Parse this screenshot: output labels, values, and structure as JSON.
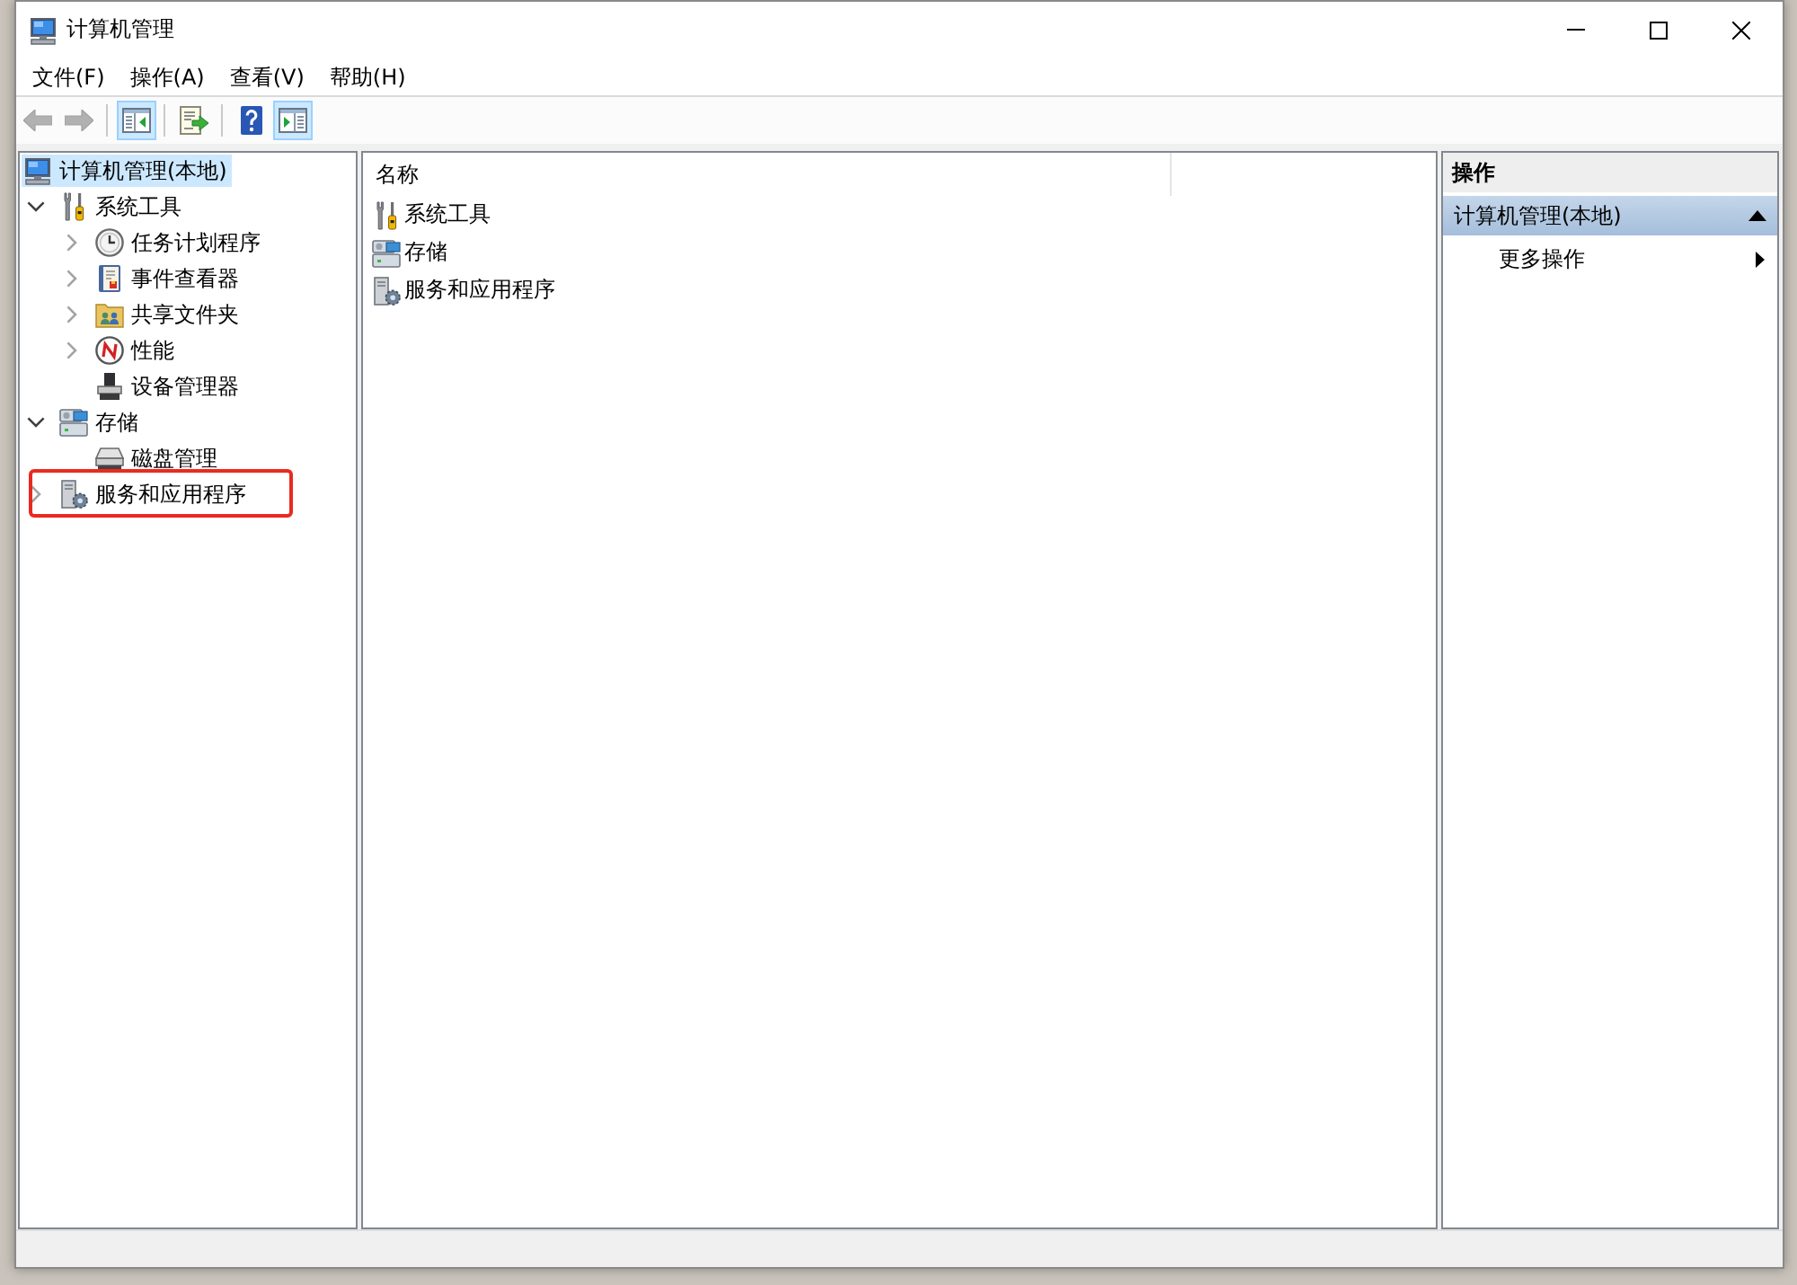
{
  "window": {
    "title": "计算机管理"
  },
  "menu": [
    "文件(F)",
    "操作(A)",
    "查看(V)",
    "帮助(H)"
  ],
  "toolbar": {
    "groups": [
      {
        "buttons": [
          {
            "disabled": true,
            "pressed": false
          },
          {
            "disabled": true,
            "pressed": false
          }
        ]
      },
      {
        "buttons": [
          {
            "disabled": false,
            "pressed": true
          }
        ]
      },
      {
        "buttons": [
          {
            "disabled": false,
            "pressed": false
          }
        ]
      },
      {
        "buttons": [
          {
            "disabled": false,
            "pressed": false
          },
          {
            "disabled": false,
            "pressed": true
          }
        ]
      }
    ]
  },
  "tree": {
    "root": {
      "label": "计算机管理(本地)",
      "selected": true,
      "children": [
        {
          "label": "系统工具",
          "expanded": true,
          "selected": false,
          "outlined": false,
          "children": [
            {
              "label": "任务计划程序",
              "expanded": false,
              "selected": false,
              "outlined": false
            },
            {
              "label": "事件查看器",
              "expanded": false,
              "selected": false,
              "outlined": false
            },
            {
              "label": "共享文件夹",
              "expanded": false,
              "selected": false,
              "outlined": false
            },
            {
              "label": "性能",
              "expanded": false,
              "selected": false,
              "outlined": false
            },
            {
              "label": "设备管理器",
              "selected": false,
              "outlined": false
            }
          ]
        },
        {
          "label": "存储",
          "expanded": true,
          "selected": false,
          "outlined": false,
          "children": [
            {
              "label": "磁盘管理",
              "selected": false,
              "outlined": false
            }
          ]
        },
        {
          "label": "服务和应用程序",
          "expanded": false,
          "selected": false,
          "outlined": true
        }
      ]
    }
  },
  "list": {
    "columns": [
      "名称"
    ],
    "rows": [
      "系统工具",
      "存储",
      "服务和应用程序"
    ]
  },
  "actions": {
    "title": "操作",
    "sections": [
      {
        "title": "计算机管理(本地)",
        "expanded": true,
        "items": [
          {
            "label": "更多操作",
            "submenu": true
          }
        ]
      }
    ]
  }
}
